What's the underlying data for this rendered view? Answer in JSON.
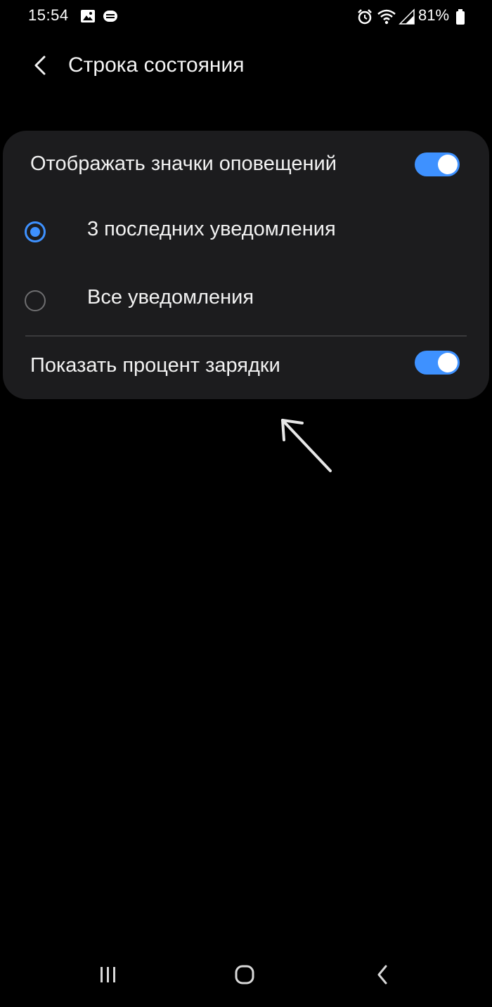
{
  "status_bar": {
    "time": "15:54",
    "battery_percent": "81%",
    "icons": [
      "gallery-icon",
      "message-icon",
      "alarm-icon",
      "wifi-icon",
      "signal-icon",
      "battery-icon"
    ]
  },
  "header": {
    "title": "Строка состояния",
    "back_icon": "chevron-left-icon"
  },
  "settings": {
    "show_notification_icons": {
      "label": "Отображать значки оповещений",
      "enabled": true
    },
    "notification_options": [
      {
        "label": "3 последних уведомления",
        "selected": true
      },
      {
        "label": "Все уведомления",
        "selected": false
      }
    ],
    "show_battery_percent": {
      "label": "Показать процент зарядки",
      "enabled": true
    }
  },
  "navigation": {
    "buttons": [
      "recent-apps-icon",
      "home-icon",
      "back-icon"
    ]
  },
  "colors": {
    "background": "#000000",
    "card": "#1c1c1e",
    "accent": "#3e91ff",
    "text": "#f2f2f2",
    "divider": "#3a3a3c"
  }
}
